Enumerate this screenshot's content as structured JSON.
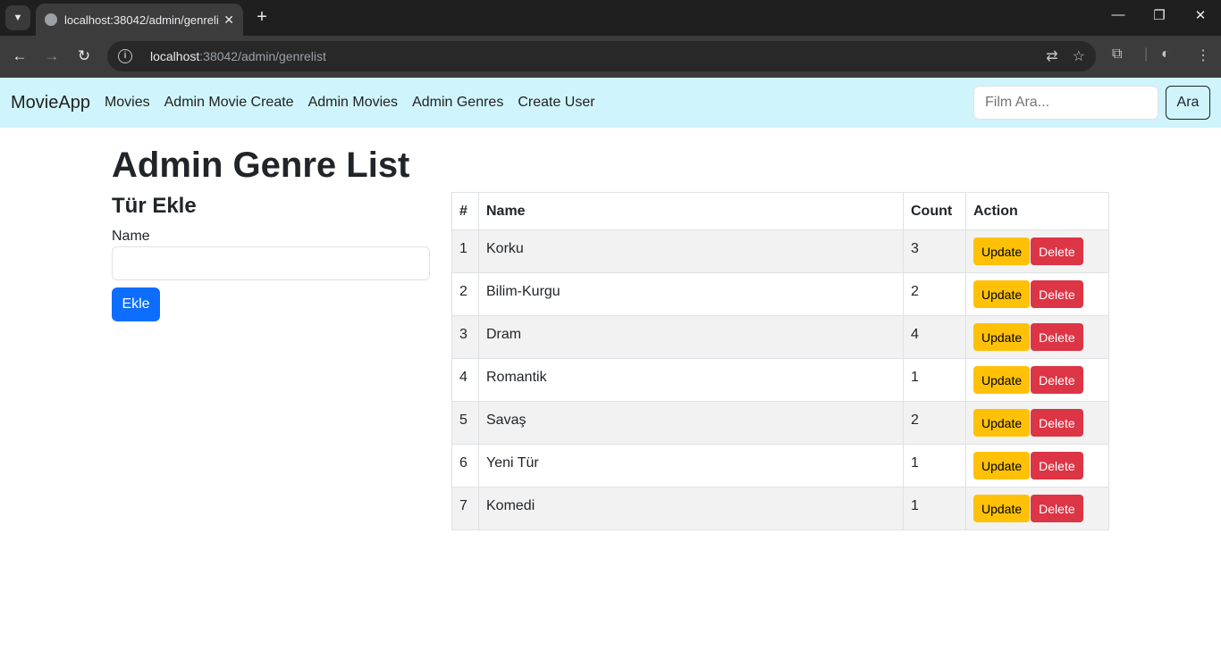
{
  "browser": {
    "tab_title": "localhost:38042/admin/genrelist",
    "tab_close": "✕",
    "new_tab": "+",
    "url_host": "localhost",
    "url_path": ":38042/admin/genrelist"
  },
  "navbar": {
    "brand": "MovieApp",
    "links": [
      "Movies",
      "Admin Movie Create",
      "Admin Movies",
      "Admin Genres",
      "Create User"
    ],
    "search_placeholder": "Film Ara...",
    "search_button": "Ara"
  },
  "page": {
    "title": "Admin Genre List",
    "form_title": "Tür Ekle",
    "name_label": "Name",
    "add_button": "Ekle"
  },
  "table": {
    "headers": [
      "#",
      "Name",
      "Count",
      "Action"
    ],
    "update_label": "Update",
    "delete_label": "Delete",
    "rows": [
      {
        "id": "1",
        "name": "Korku",
        "count": "3"
      },
      {
        "id": "2",
        "name": "Bilim-Kurgu",
        "count": "2"
      },
      {
        "id": "3",
        "name": "Dram",
        "count": "4"
      },
      {
        "id": "4",
        "name": "Romantik",
        "count": "1"
      },
      {
        "id": "5",
        "name": "Savaş",
        "count": "2"
      },
      {
        "id": "6",
        "name": "Yeni Tür",
        "count": "1"
      },
      {
        "id": "7",
        "name": "Komedi",
        "count": "1"
      }
    ]
  },
  "colors": {
    "navbar_bg": "#cff4fc",
    "primary": "#0d6efd",
    "warning": "#ffc107",
    "danger": "#dc3545"
  }
}
